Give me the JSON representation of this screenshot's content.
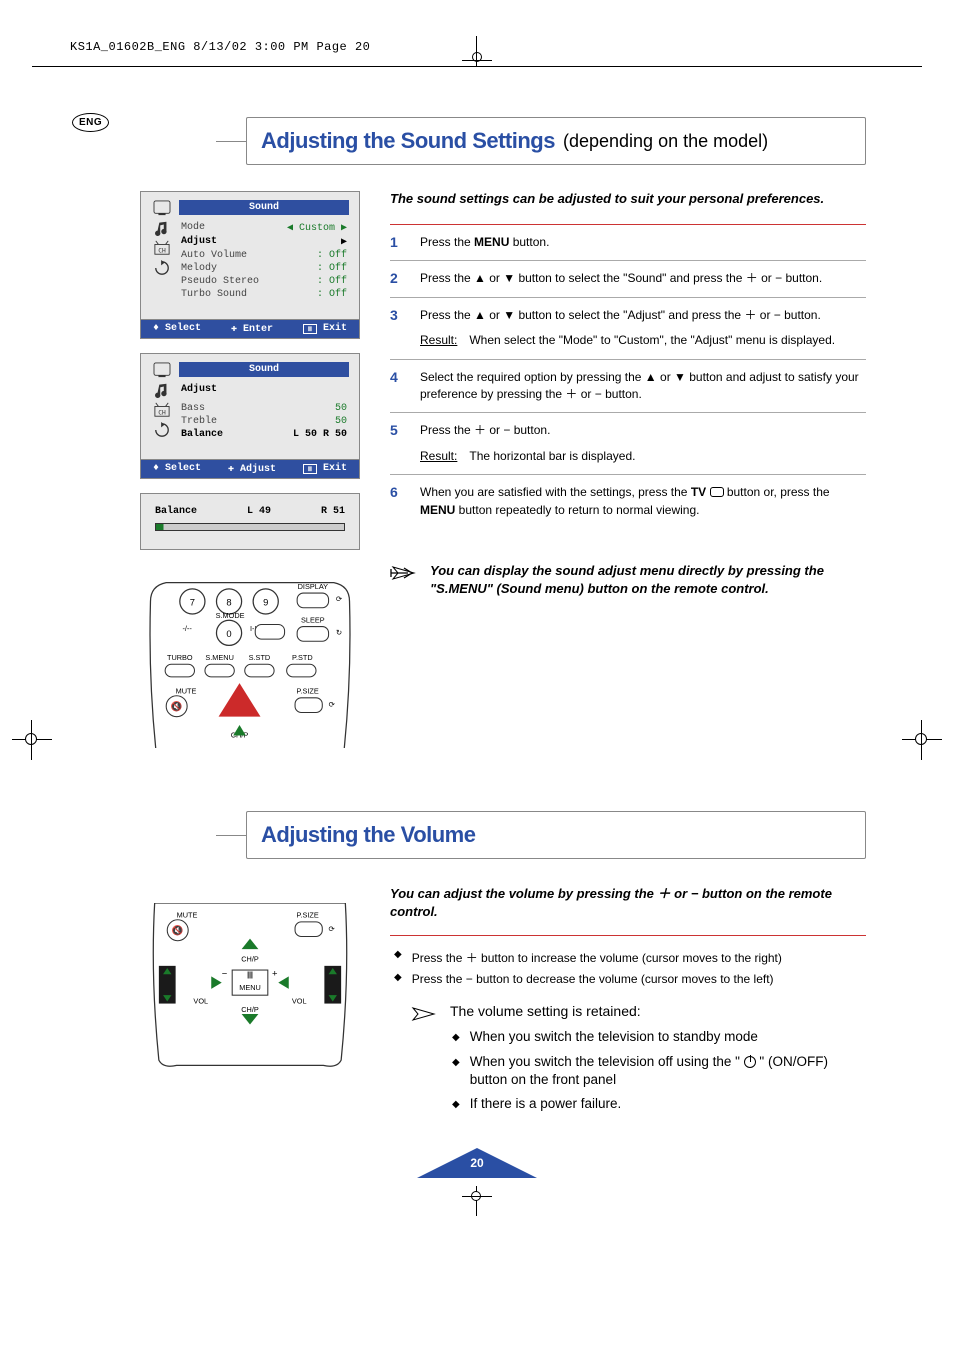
{
  "print_header": "KS1A_01602B_ENG  8/13/02  3:00 PM  Page 20",
  "lang_badge": "ENG",
  "section1": {
    "title_main": "Adjusting the Sound Settings",
    "title_sub": "(depending on the model)",
    "intro": "The sound settings can be adjusted to suit your personal preferences.",
    "steps": [
      {
        "n": "1",
        "html": "Press the <b>MENU</b> button."
      },
      {
        "n": "2",
        "html": "Press the ▲ or ▼ button to select the \"Sound\" and press the ＋ or − button."
      },
      {
        "n": "3",
        "html": "Press the ▲ or ▼ button to select the \"Adjust\" and press the ＋ or − button.",
        "result": "When select the \"Mode\" to \"Custom\", the \"Adjust\" menu is displayed."
      },
      {
        "n": "4",
        "html": "Select the required option by pressing the ▲ or ▼ button and adjust to satisfy your preference by pressing the ＋ or − button."
      },
      {
        "n": "5",
        "html": "Press the ＋ or − button.",
        "result": "The horizontal bar is displayed."
      },
      {
        "n": "6",
        "html": "When you are satisfied with the settings, press the <b>TV</b> <span class='tv-sym'></span> button or, press the <b>MENU</b> button repeatedly to return to normal viewing."
      }
    ],
    "result_label": "Result:",
    "note": "You can display the sound adjust menu directly by pressing the \"S.MENU\" (Sound menu) button on the remote control."
  },
  "osd1": {
    "title": "Sound",
    "rows": [
      {
        "k": "Mode",
        "v": "◀   Custom   ▶",
        "hl": false
      },
      {
        "k": "Adjust",
        "v": "▶",
        "hl": true
      },
      {
        "k": "Auto Volume",
        "v": ": Off",
        "hl": false
      },
      {
        "k": "Melody",
        "v": ": Off",
        "hl": false
      },
      {
        "k": "Pseudo Stereo",
        "v": ": Off",
        "hl": false
      },
      {
        "k": "Turbo Sound",
        "v": ": Off",
        "hl": false
      }
    ],
    "footer": {
      "a": "♦ Select",
      "b": "✚ Enter",
      "c": "Ⅲ Exit"
    }
  },
  "osd2": {
    "title": "Sound",
    "header_row": "Adjust",
    "rows": [
      {
        "k": "Bass",
        "v": "50",
        "hl": false
      },
      {
        "k": "Treble",
        "v": "50",
        "hl": false
      },
      {
        "k": "Balance",
        "v": "L 50   R 50",
        "hl": true
      }
    ],
    "footer": {
      "a": "♦ Select",
      "b": "✚ Adjust",
      "c": "Ⅲ Exit"
    }
  },
  "balance_bar": {
    "label": "Balance",
    "left": "L 49",
    "right": "R 51"
  },
  "remote1": {
    "labels": [
      "DISPLAY",
      "SLEEP",
      "TURBO",
      "S.MENU",
      "S.STD",
      "P.STD",
      "MUTE",
      "P.SIZE",
      "CH/P",
      "S.MODE",
      "I-II",
      "-/--"
    ],
    "nums": [
      "7",
      "8",
      "9",
      "0"
    ]
  },
  "section2": {
    "title_main": "Adjusting the Volume",
    "intro": "You can adjust the volume by pressing the ＋ or − button on the remote control.",
    "bullets": [
      "Press the ＋ button to increase the volume (cursor moves to the right)",
      "Press the − button to decrease the volume (cursor moves to the left)"
    ],
    "note_lead": "The volume setting is retained:",
    "note_items": [
      "When you switch the television to standby mode",
      "When you switch the television off using the \" <power> \" (ON/OFF) button on the front panel",
      "If there is a power failure."
    ]
  },
  "remote2": {
    "labels": [
      "MUTE",
      "P.SIZE",
      "CH/P",
      "MENU",
      "VOL",
      "VOL",
      "CH/P"
    ]
  },
  "page_number": "20"
}
